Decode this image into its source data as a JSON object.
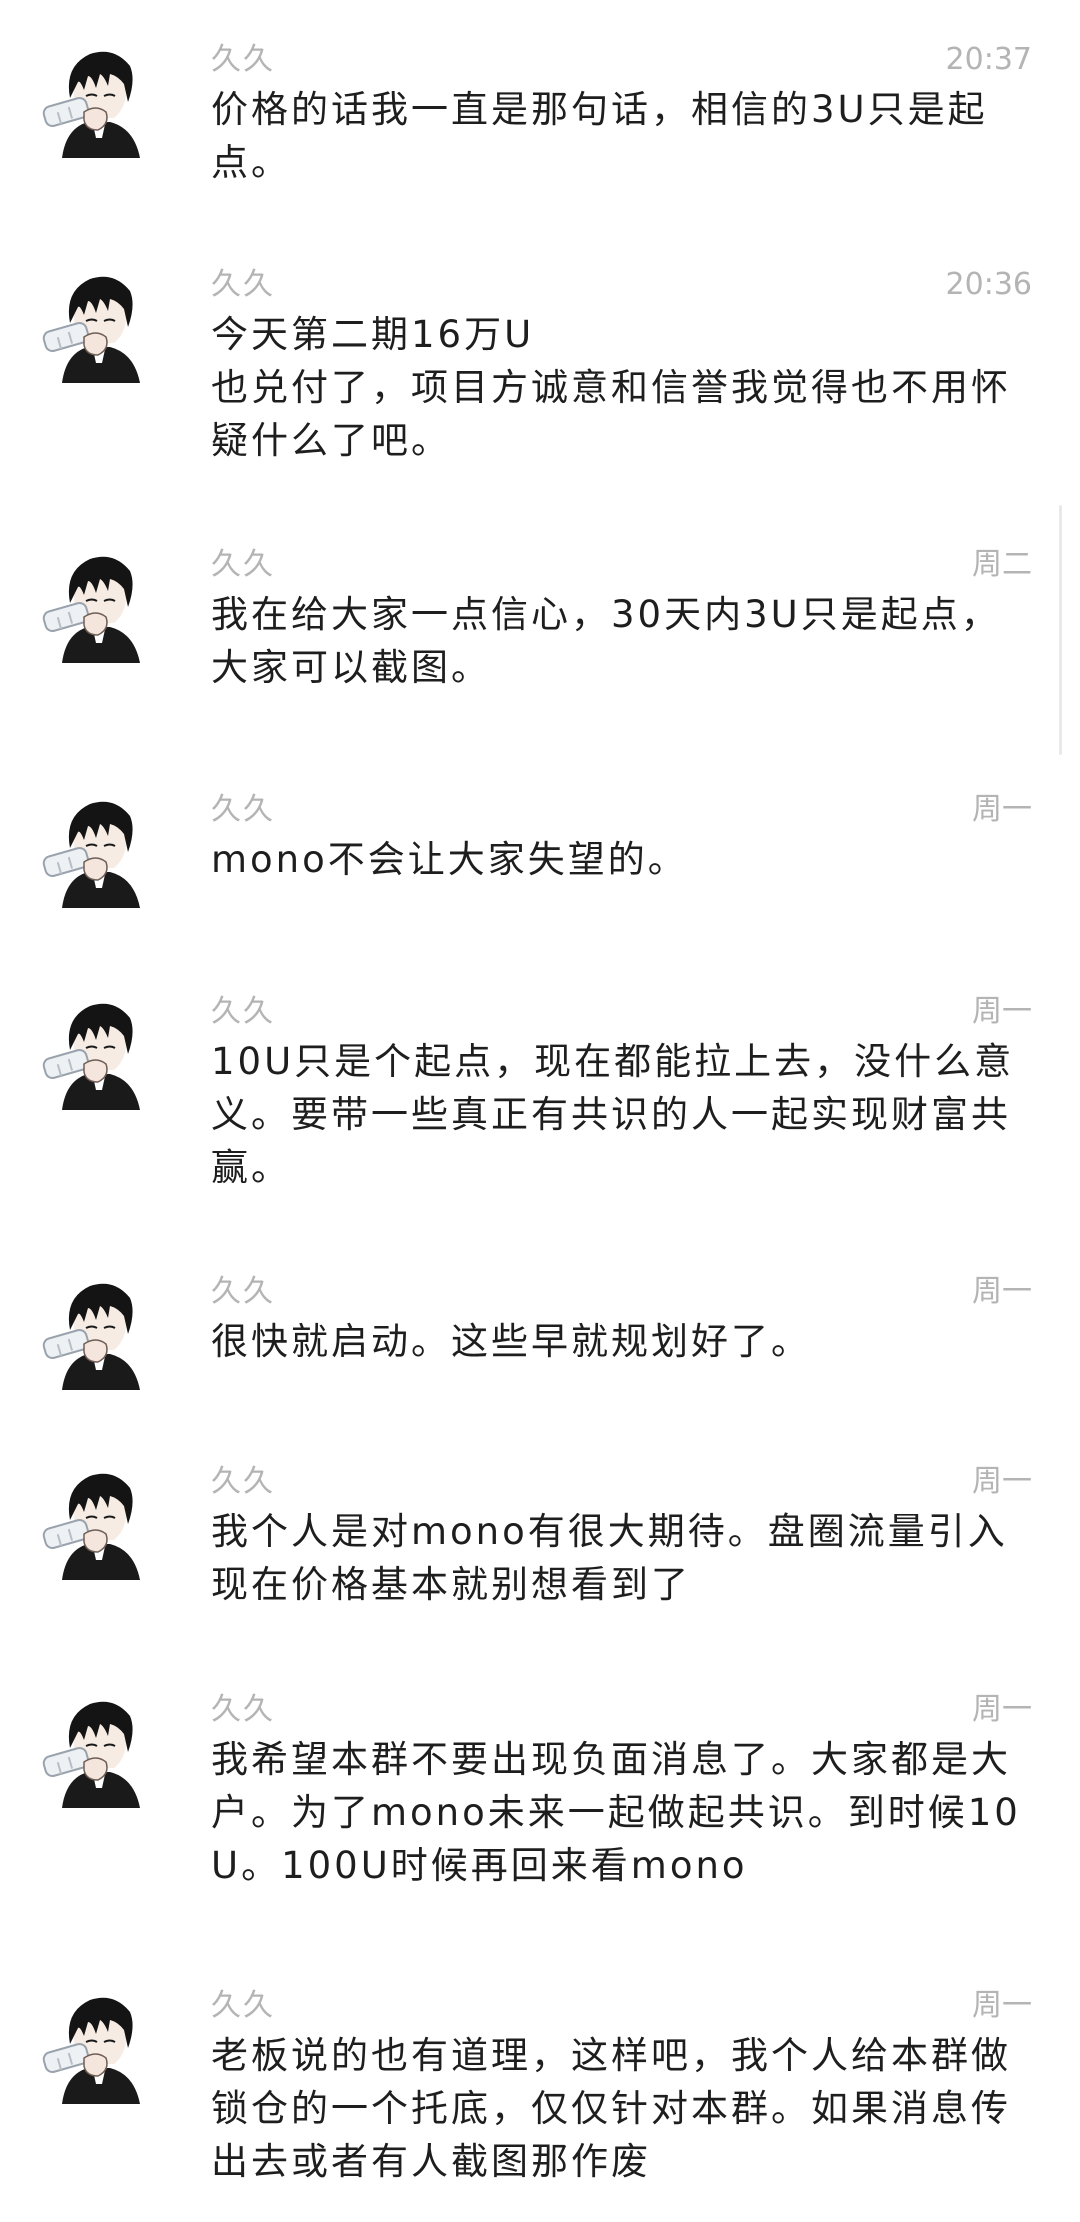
{
  "messages": [
    {
      "sender": "久久",
      "time": "20:37",
      "text": "价格的话我一直是那句话，相信的3U只是起点。"
    },
    {
      "sender": "久久",
      "time": "20:36",
      "text": "今天第二期16万U\n也兑付了，项目方诚意和信誉我觉得也不用怀疑什么了吧。"
    },
    {
      "sender": "久久",
      "time": "周二",
      "text": "我在给大家一点信心，30天内3U只是起点，大家可以截图。"
    },
    {
      "sender": "久久",
      "time": "周一",
      "text": "mono不会让大家失望的。"
    },
    {
      "sender": "久久",
      "time": "周一",
      "text": "10U只是个起点，现在都能拉上去，没什么意义。要带一些真正有共识的人一起实现财富共赢。"
    },
    {
      "sender": "久久",
      "time": "周一",
      "text": "很快就启动。这些早就规划好了。"
    },
    {
      "sender": "久久",
      "time": "周一",
      "text": "我个人是对mono有很大期待。盘圈流量引入现在价格基本就别想看到了"
    },
    {
      "sender": "久久",
      "time": "周一",
      "text": "我希望本群不要出现负面消息了。大家都是大户。为了mono未来一起做起共识。到时候10U。100U时候再回来看mono"
    },
    {
      "sender": "久久",
      "time": "周一",
      "text": "老板说的也有道理，这样吧，我个人给本群做锁仓的一个托底，仅仅针对本群。如果消息传出去或者有人截图那作废"
    }
  ]
}
